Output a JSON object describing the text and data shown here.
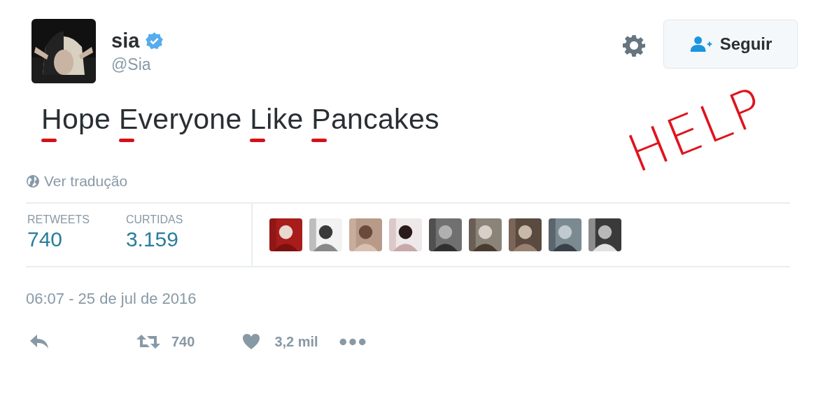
{
  "user": {
    "name": "sia",
    "verified": true,
    "handle": "@Sia"
  },
  "follow_button": {
    "label": "Seguir"
  },
  "tweet_text": [
    {
      "word": "Hope",
      "underlined": true
    },
    {
      "word": "Everyone",
      "underlined": true
    },
    {
      "word": "Like",
      "underlined": true
    },
    {
      "word": "Pancakes",
      "underlined": true
    }
  ],
  "annotation": "HELP",
  "translate_link": "Ver tradução",
  "stats": [
    {
      "label": "RETWEETS",
      "value": "740"
    },
    {
      "label": "CURTIDAS",
      "value": "3.159"
    }
  ],
  "timestamp": "06:07 - 25 de jul de 2016",
  "actions": [
    {
      "kind": "reply"
    },
    {
      "kind": "retweet",
      "count": "740"
    },
    {
      "kind": "like",
      "count": "3,2 mil"
    },
    {
      "kind": "more"
    }
  ]
}
